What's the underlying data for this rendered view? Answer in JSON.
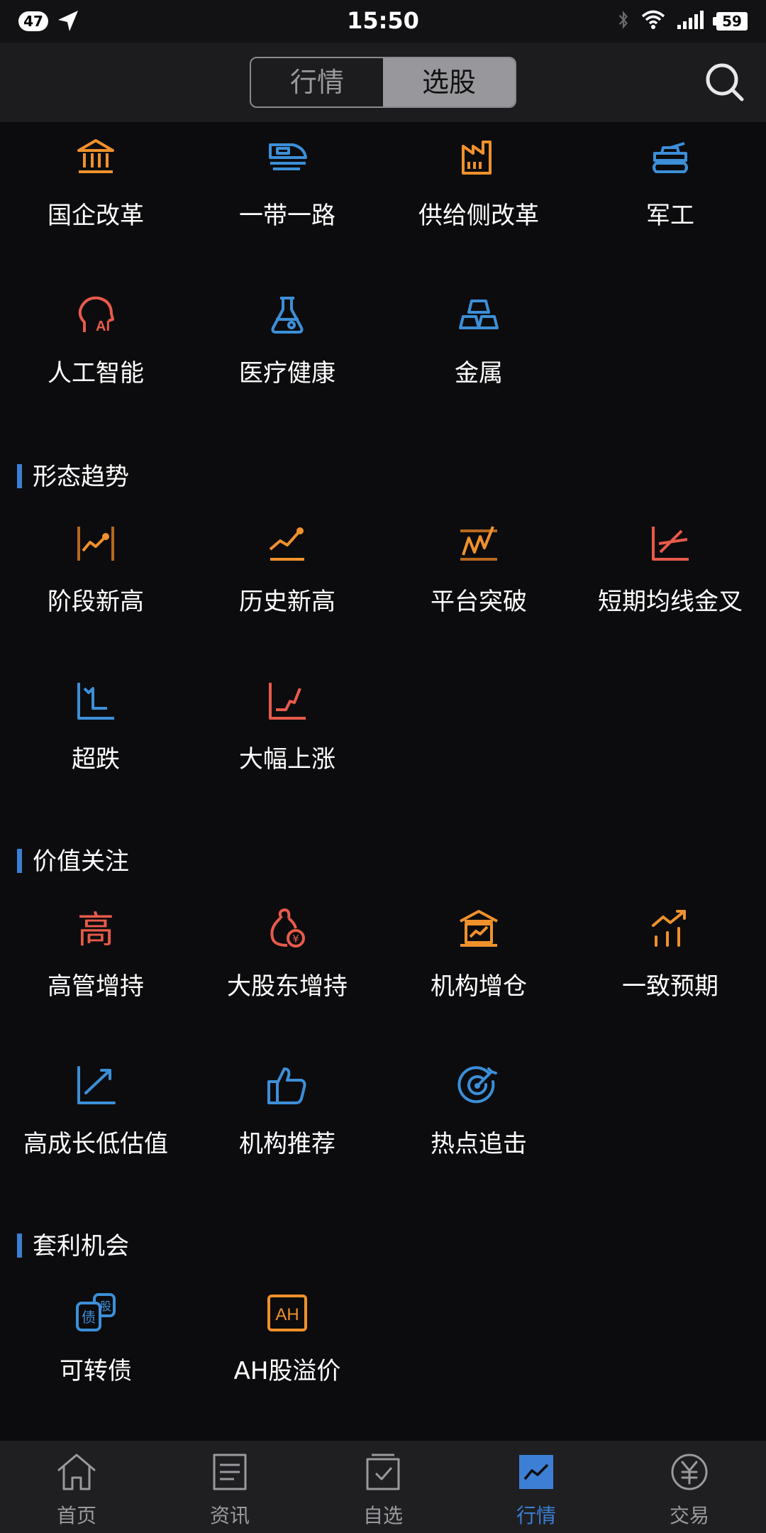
{
  "status_bar": {
    "notification_count": "47",
    "time": "15:50",
    "battery": "59",
    "icons": [
      "navigation-arrow-icon",
      "bluetooth-icon",
      "wifi-icon",
      "signal-icon",
      "battery-icon"
    ]
  },
  "header": {
    "tabs": [
      {
        "label": "行情",
        "active": false
      },
      {
        "label": "选股",
        "active": true
      }
    ],
    "search_icon": "search-icon"
  },
  "sections": [
    {
      "title": "",
      "items": [
        {
          "label": "国企改革",
          "icon": "bank-building-icon",
          "color": "#f0912c"
        },
        {
          "label": "一带一路",
          "icon": "high-speed-train-icon",
          "color": "#3c8fd8"
        },
        {
          "label": "供给侧改革",
          "icon": "factory-icon",
          "color": "#f0912c"
        },
        {
          "label": "军工",
          "icon": "tank-icon",
          "color": "#3c8fd8"
        },
        {
          "label": "人工智能",
          "icon": "ai-head-icon",
          "color": "#e85a4a"
        },
        {
          "label": "医疗健康",
          "icon": "flask-icon",
          "color": "#3c8fd8"
        },
        {
          "label": "金属",
          "icon": "gold-bars-icon",
          "color": "#3c8fd8"
        }
      ]
    },
    {
      "title": "形态趋势",
      "items": [
        {
          "label": "阶段新高",
          "icon": "stage-high-chart-icon",
          "color": "#f0912c"
        },
        {
          "label": "历史新高",
          "icon": "history-high-chart-icon",
          "color": "#f0912c"
        },
        {
          "label": "平台突破",
          "icon": "platform-breakout-icon",
          "color": "#f0912c"
        },
        {
          "label": "短期均线金叉",
          "icon": "golden-cross-icon",
          "color": "#e85a4a"
        },
        {
          "label": "超跌",
          "icon": "oversold-chart-icon",
          "color": "#3c8fd8"
        },
        {
          "label": "大幅上涨",
          "icon": "sharp-rise-chart-icon",
          "color": "#e85a4a"
        }
      ]
    },
    {
      "title": "价值关注",
      "items": [
        {
          "label": "高管增持",
          "icon": "gao-character-icon",
          "color": "#e85a4a",
          "glyph": "高"
        },
        {
          "label": "大股东增持",
          "icon": "money-bag-icon",
          "color": "#e85a4a"
        },
        {
          "label": "机构增仓",
          "icon": "institution-chart-icon",
          "color": "#f0912c"
        },
        {
          "label": "一致预期",
          "icon": "rising-bars-icon",
          "color": "#f0912c"
        },
        {
          "label": "高成长低估值",
          "icon": "growth-arrow-icon",
          "color": "#3c8fd8"
        },
        {
          "label": "机构推荐",
          "icon": "thumbs-up-icon",
          "color": "#3c8fd8"
        },
        {
          "label": "热点追击",
          "icon": "target-icon",
          "color": "#3c8fd8"
        }
      ]
    },
    {
      "title": "套利机会",
      "items": [
        {
          "label": "可转债",
          "icon": "convertible-bond-icon",
          "color": "#3c8fd8",
          "glyph_a": "债",
          "glyph_b": "股"
        },
        {
          "label": "AH股溢价",
          "icon": "ah-premium-icon",
          "color": "#f0912c",
          "glyph": "AH"
        }
      ]
    }
  ],
  "tabbar": [
    {
      "label": "首页",
      "icon": "home-icon",
      "active": false
    },
    {
      "label": "资讯",
      "icon": "news-icon",
      "active": false
    },
    {
      "label": "自选",
      "icon": "watchlist-icon",
      "active": false
    },
    {
      "label": "行情",
      "icon": "market-chart-icon",
      "active": true
    },
    {
      "label": "交易",
      "icon": "yuan-icon",
      "active": false
    }
  ],
  "colors": {
    "accent_blue": "#3c7fd4",
    "orange": "#f0912c",
    "red": "#e85a4a",
    "blue": "#3c8fd8"
  }
}
